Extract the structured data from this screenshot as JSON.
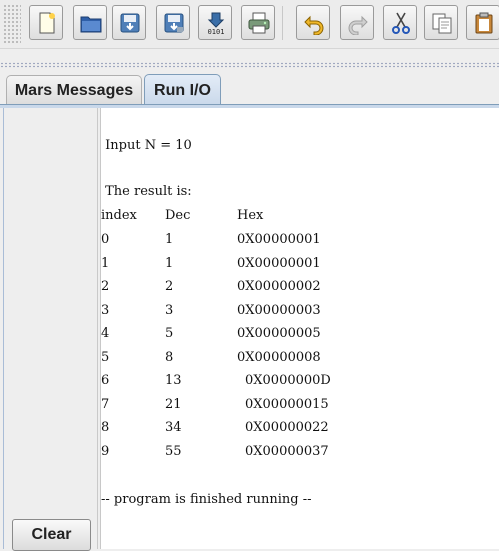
{
  "toolbar": {
    "buttons": [
      {
        "name": "new-file-icon"
      },
      {
        "name": "open-folder-icon"
      },
      {
        "name": "save-icon"
      },
      {
        "name": "save-as-icon"
      },
      {
        "name": "dump-memory-icon",
        "label": "0101"
      },
      {
        "name": "print-icon"
      },
      {
        "name": "undo-icon"
      },
      {
        "name": "redo-icon"
      },
      {
        "name": "cut-icon"
      },
      {
        "name": "copy-icon"
      },
      {
        "name": "paste-icon"
      }
    ]
  },
  "tabs": [
    {
      "label": "Mars Messages",
      "active": false
    },
    {
      "label": "Run I/O",
      "active": true
    }
  ],
  "left_panel": {
    "clear_label": "Clear"
  },
  "console": {
    "input_line": " Input N = 10",
    "result_line": " The result is:",
    "headers": {
      "index": "index",
      "dec": "Dec",
      "hex": "Hex"
    },
    "rows": [
      {
        "index": "0",
        "dec": "1",
        "hex": "0X00000001"
      },
      {
        "index": "1",
        "dec": "1",
        "hex": "0X00000001"
      },
      {
        "index": "2",
        "dec": "2",
        "hex": "0X00000002"
      },
      {
        "index": "3",
        "dec": "3",
        "hex": "0X00000003"
      },
      {
        "index": "4",
        "dec": "5",
        "hex": "0X00000005"
      },
      {
        "index": "5",
        "dec": "8",
        "hex": "0X00000008"
      },
      {
        "index": "6",
        "dec": "13",
        "hex": "0X0000000D"
      },
      {
        "index": "7",
        "dec": "21",
        "hex": "0X00000015"
      },
      {
        "index": "8",
        "dec": "34",
        "hex": "0X00000022"
      },
      {
        "index": "9",
        "dec": "55",
        "hex": "0X00000037"
      }
    ],
    "finished_line": "-- program is finished running --"
  },
  "colors": {
    "active_tab": "#c9d8ea",
    "background": "#eeeeee",
    "console_bg": "#ffffff"
  }
}
